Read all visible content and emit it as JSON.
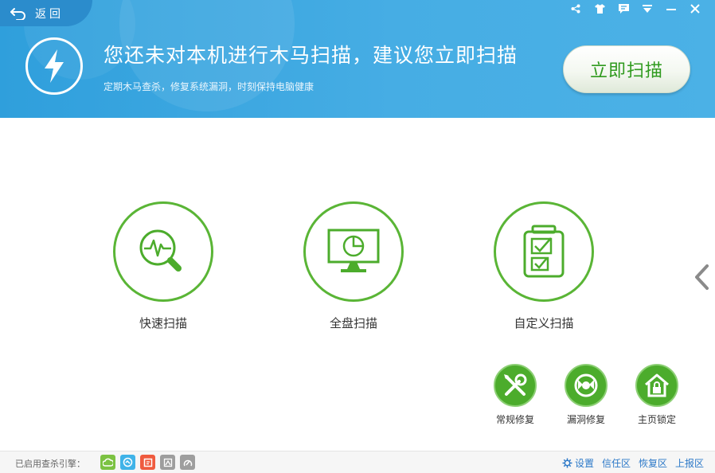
{
  "header": {
    "back_label": "返回",
    "headline": "您还未对本机进行木马扫描，建议您立即扫描",
    "subline": "定期木马查杀，修复系统漏洞，时刻保持电脑健康",
    "scan_now_label": "立即扫描",
    "window_controls": [
      "share-icon",
      "skin-icon",
      "feedback-icon",
      "menu-icon",
      "minimize-icon",
      "close-icon"
    ]
  },
  "scan_options": [
    {
      "label": "快速扫描",
      "icon": "quick-scan-icon"
    },
    {
      "label": "全盘扫描",
      "icon": "full-scan-icon"
    },
    {
      "label": "自定义扫描",
      "icon": "custom-scan-icon"
    }
  ],
  "tools": [
    {
      "label": "常规修复",
      "icon": "wrench-icon"
    },
    {
      "label": "漏洞修复",
      "icon": "patch-icon"
    },
    {
      "label": "主页锁定",
      "icon": "home-lock-icon"
    }
  ],
  "footer": {
    "engine_label": "已启用查杀引擎：",
    "engines": [
      {
        "icon": "cloud-engine-icon",
        "color": "#7cc242"
      },
      {
        "icon": "qvm-engine-icon",
        "color": "#3fb3e8"
      },
      {
        "icon": "bitdefender-engine-icon",
        "color": "#ef5b3f"
      },
      {
        "icon": "disabled-engine-icon",
        "color": "#9e9e9e"
      },
      {
        "icon": "avira-engine-icon",
        "color": "#9e9e9e"
      }
    ],
    "settings_label": "设置",
    "trust_label": "信任区",
    "restore_label": "恢复区",
    "report_label": "上报区"
  },
  "colors": {
    "header_blue": "#3ea7e1",
    "accent_green": "#5ab536",
    "link_blue": "#2b78c8"
  }
}
